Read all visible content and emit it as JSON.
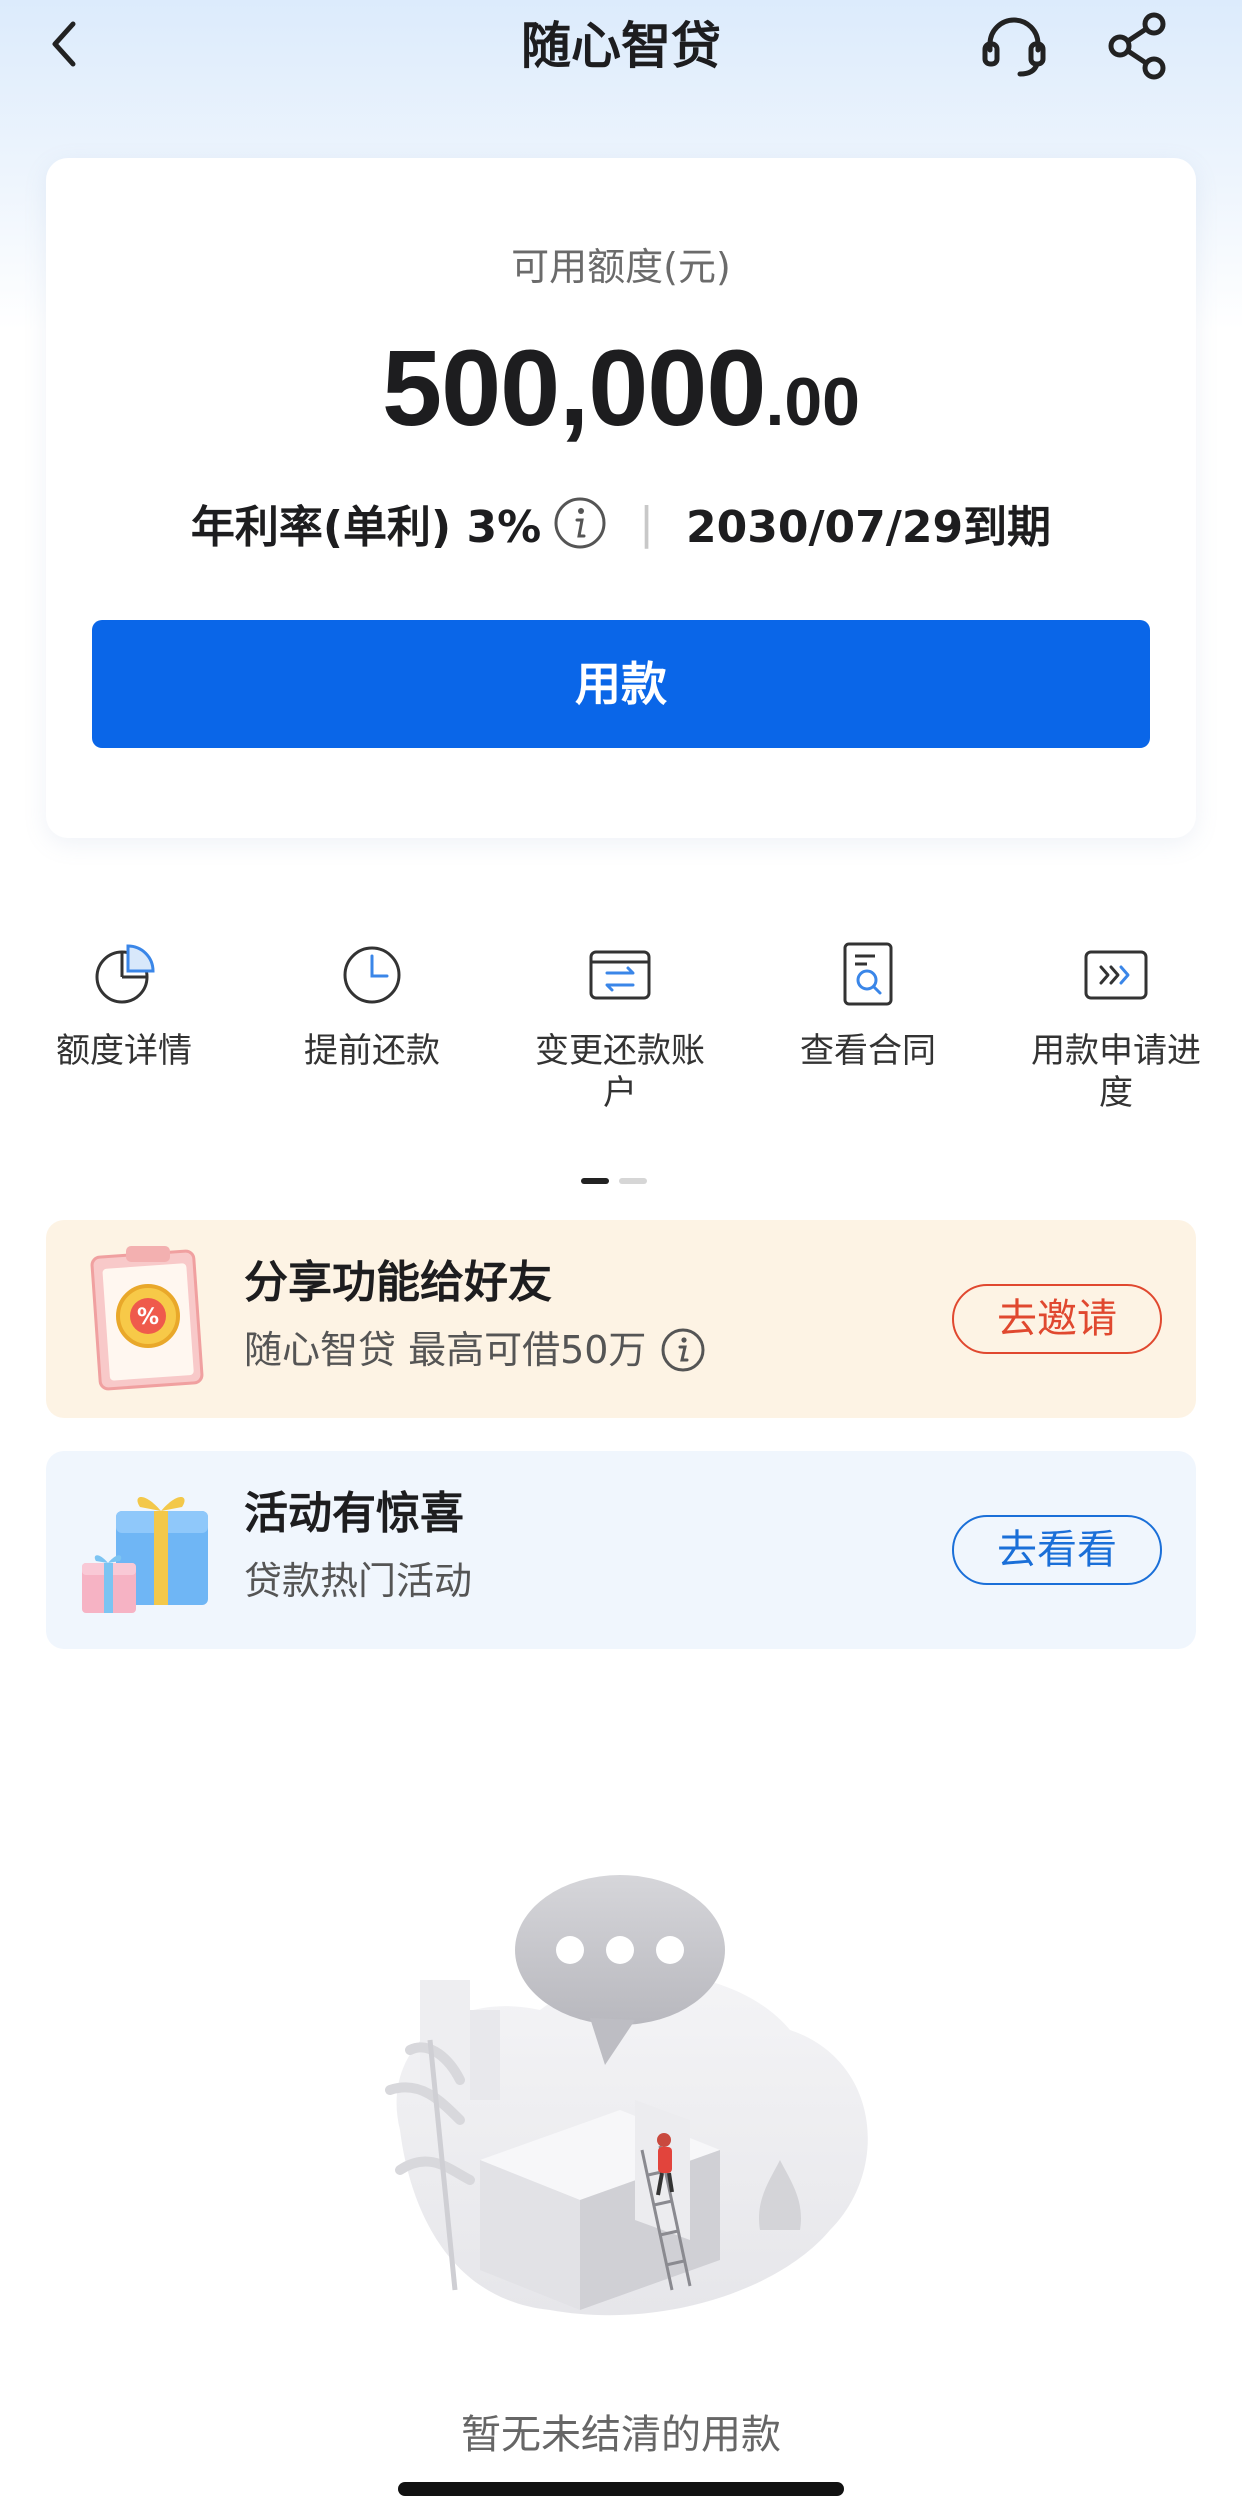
{
  "header": {
    "title": "随心智贷",
    "back_icon": "chevron-left-icon",
    "support_icon": "headset-icon",
    "share_icon": "share-icon"
  },
  "credit": {
    "label": "可用额度(元)",
    "amount_integer": "500,000",
    "amount_decimal": ".00",
    "rate_text": "年利率(单利) 3%",
    "separator": "|",
    "due_text": "2030/07/29到期",
    "button_label": "用款"
  },
  "actions": [
    {
      "label": "额度详情",
      "icon": "pie-chart-icon"
    },
    {
      "label": "提前还款",
      "icon": "clock-icon"
    },
    {
      "label": "变更还款账户",
      "icon": "card-exchange-icon"
    },
    {
      "label": "查看合同",
      "icon": "contract-search-icon"
    },
    {
      "label": "用款申请进度",
      "icon": "progress-arrows-icon"
    }
  ],
  "promos": {
    "share": {
      "title": "分享功能给好友",
      "subtitle": "随心智贷 最高可借50万",
      "button": "去邀请"
    },
    "activity": {
      "title": "活动有惊喜",
      "subtitle": "贷款热门活动",
      "button": "去看看"
    }
  },
  "empty_state": {
    "text": "暂无未结清的用款"
  },
  "colors": {
    "primary": "#0a66e8",
    "invite": "#e0482f",
    "view": "#1a6fd8",
    "share_bg": "#fdf3e4",
    "activity_bg": "#f0f6fd"
  }
}
